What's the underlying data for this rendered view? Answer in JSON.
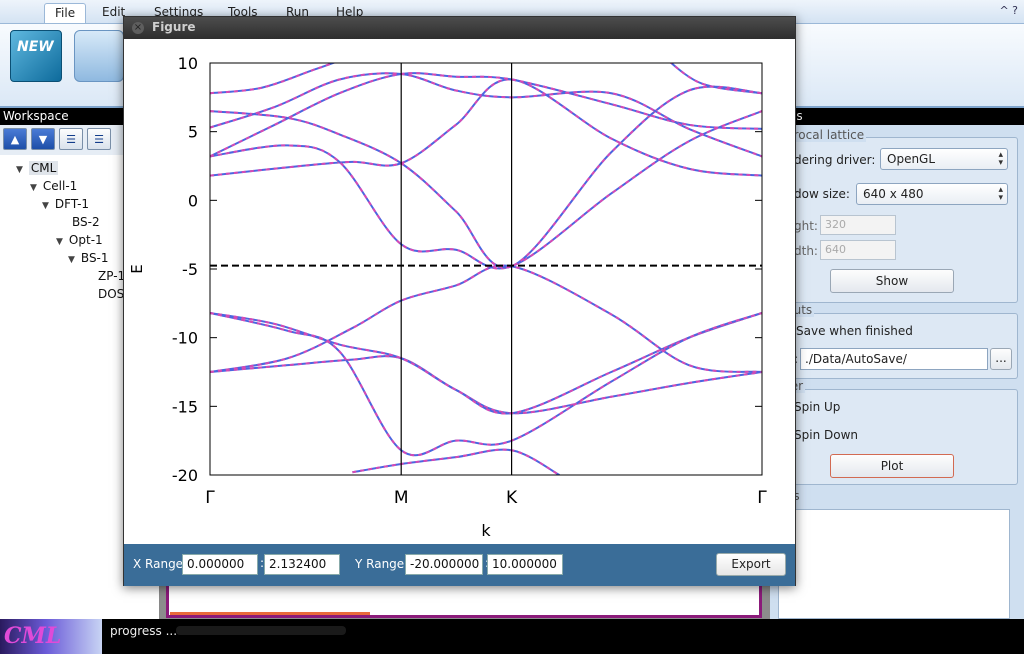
{
  "menu": {
    "items": [
      "File",
      "Edit",
      "Settings",
      "Tools",
      "Run",
      "Help"
    ],
    "active": "File",
    "right_icons": "^ ?"
  },
  "ribbon": {
    "new_label": "NEW"
  },
  "workspace": {
    "title": "Workspace",
    "toolbar_icons": [
      "arrow-up-icon",
      "arrow-down-icon",
      "list-expand-icon",
      "list-collapse-icon"
    ],
    "tree": [
      "CML",
      "Cell-1",
      "DFT-1",
      "BS-2",
      "Opt-1",
      "BS-1",
      "ZP-1",
      "DOS"
    ]
  },
  "properties": {
    "title": "rties",
    "reciprocal_title": "procal lattice",
    "render_label": "dering driver:",
    "render_value": "OpenGL",
    "window_label": "dow size:",
    "window_value": "640 x 480",
    "height_label": "ght:",
    "height_value": "320",
    "width_label": "dth:",
    "width_value": "640",
    "show_button": "Show",
    "outputs_title": "puts",
    "save_label": "Save when finished",
    "path_prefix": ":",
    "path_value": "./Data/AutoSave/",
    "browse_button": "...",
    "filter_title": "ter",
    "spin_up": "Spin Up",
    "spin_down": "Spin Down",
    "plot_button": "Plot",
    "notes_title": "es"
  },
  "statusbar": {
    "logo": "CML",
    "progress_label": "progress ..."
  },
  "figure": {
    "title": "Figure",
    "x_range_label": "X Range:",
    "x_min": "0.000000",
    "x_max": "2.132400",
    "range_sep": ":",
    "y_range_label": "Y Range:",
    "y_min": "-20.000000",
    "y_max": "10.000000",
    "export_button": "Export"
  },
  "chart_data": {
    "type": "line",
    "xlabel": "k",
    "ylabel": "E",
    "xlim": [
      0,
      2.1324
    ],
    "ylim": [
      -20,
      10
    ],
    "yticks": [
      10,
      5,
      0,
      -5,
      -10,
      -15,
      -20
    ],
    "xtick_labels": [
      "Γ",
      "M",
      "K",
      "Γ"
    ],
    "kpoint_positions": [
      0,
      0.7386,
      1.1651,
      2.1324
    ],
    "fermi_level": -4.75,
    "line_colors": [
      "#4a66e0",
      "#d64ab4"
    ],
    "bands": [
      {
        "name": "",
        "x": [
          0,
          0.3,
          0.55,
          0.7386,
          0.95,
          1.1651,
          1.55,
          1.85,
          2.1324
        ],
        "values": [
          -12.5,
          -12.0,
          -11.6,
          -11.5,
          -13.8,
          -15.5,
          -14.3,
          -13.3,
          -12.5
        ]
      },
      {
        "name": "",
        "x": [
          0,
          0.25,
          0.5,
          0.7386,
          0.95,
          1.1651,
          1.55,
          1.85,
          2.1324
        ],
        "values": [
          -8.2,
          -9.0,
          -10.5,
          -11.5,
          -13.8,
          -15.5,
          -12.5,
          -10.0,
          -8.2
        ]
      },
      {
        "name": "",
        "x": [
          0,
          0.3,
          0.55,
          0.7386,
          0.95,
          1.1651,
          1.55,
          1.85,
          2.1324
        ],
        "values": [
          -12.5,
          -11.5,
          -9.3,
          -7.3,
          -6.2,
          -4.8,
          -8.3,
          -12.0,
          -12.5
        ]
      },
      {
        "name": "",
        "x": [
          0,
          0.3,
          0.5,
          0.7386,
          0.95,
          1.1651,
          1.55,
          1.85,
          2.1324
        ],
        "values": [
          -8.2,
          -9.5,
          -11.0,
          -18.2,
          -17.5,
          -17.5,
          -13.2,
          -10.0,
          -8.2
        ]
      },
      {
        "name": "",
        "x": [
          0.55,
          0.7386,
          0.95,
          1.1651,
          1.35
        ],
        "values": [
          -19.8,
          -19.2,
          -18.7,
          -18.2,
          -20.0
        ]
      },
      {
        "name": "",
        "x": [
          0,
          0.35,
          0.55,
          0.7386,
          0.95,
          1.1651,
          1.55,
          1.85,
          2.1324
        ],
        "values": [
          1.8,
          2.5,
          2.8,
          2.7,
          5.5,
          8.8,
          4.5,
          2.3,
          1.8
        ]
      },
      {
        "name": "",
        "x": [
          0,
          0.3,
          0.5,
          0.7386,
          0.95,
          1.1651,
          1.55,
          1.85,
          2.1324
        ],
        "values": [
          3.2,
          4.0,
          2.8,
          -3.2,
          -3.6,
          -4.8,
          0.5,
          4.3,
          6.5
        ]
      },
      {
        "name": "",
        "x": [
          0,
          0.3,
          0.5,
          0.7386,
          0.95,
          1.1651,
          1.55,
          1.85,
          2.1324
        ],
        "values": [
          6.5,
          6.0,
          4.8,
          2.7,
          -0.8,
          -4.8,
          3.5,
          8.0,
          7.8
        ]
      },
      {
        "name": "",
        "x": [
          0,
          0.25,
          0.5,
          0.7386,
          0.95,
          1.1651,
          1.55,
          1.85,
          2.1324
        ],
        "values": [
          3.2,
          5.5,
          7.8,
          9.2,
          9.0,
          8.8,
          7.0,
          5.5,
          5.2
        ]
      },
      {
        "name": "",
        "x": [
          0,
          0.25,
          0.5,
          0.7386,
          0.95,
          1.1651,
          1.55,
          1.85,
          2.1324
        ],
        "values": [
          5.3,
          6.8,
          8.8,
          9.2,
          8.0,
          7.5,
          7.8,
          5.2,
          3.2
        ]
      },
      {
        "name": "",
        "x": [
          0,
          0.2,
          0.4,
          0.55
        ],
        "values": [
          7.8,
          8.2,
          9.5,
          10.5
        ]
      },
      {
        "name": "",
        "x": [
          1.75,
          1.9,
          2.1324
        ],
        "values": [
          10.5,
          8.5,
          7.8
        ]
      }
    ]
  }
}
